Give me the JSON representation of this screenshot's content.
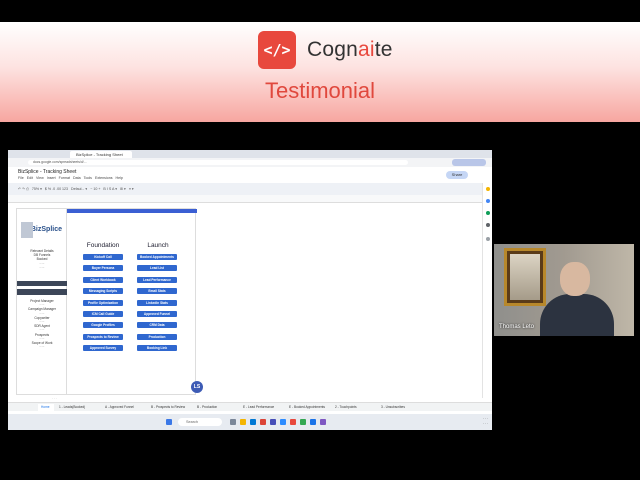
{
  "banner": {
    "logo_glyph": "</>",
    "brand_prefix": "Cogn",
    "brand_ai": "ai",
    "brand_suffix": "te",
    "subtitle": "Testimonial",
    "accent_color": "#e8483d"
  },
  "browser": {
    "tab_label": "BizSplice - Tracking Sheet",
    "doc_title": "BizSplice - Tracking Sheet",
    "share_label": "Share"
  },
  "sheet": {
    "sidebar_logo": "BizSplice",
    "foundation_heading": "Foundation",
    "launch_heading": "Launch",
    "foundation_buttons": [
      "Kickoff Call",
      "Buyer Persona",
      "Client Workbook",
      "Messaging Scripts",
      "Profile Optimization",
      "ICM Call Guide",
      "Google Profiles",
      "Prospects to Review",
      "Approved Survey"
    ],
    "launch_buttons": [
      "Booked Appointments",
      "Lead List",
      "Lead Performance",
      "Email Stats",
      "LinkedIn Stats",
      "Approved Funnel",
      "CRM Data",
      "Production",
      "Booking Link"
    ],
    "badge": "LS"
  },
  "sheet_tabs": [
    "Home",
    "1 - Leads(Booked)",
    "A - Approved Funnel",
    "B - Prospects to Review",
    "B - Production",
    "E - Lead Performance",
    "E - Booked Appointments",
    "2 - Touchpoints",
    "3 - Unsubscribes"
  ],
  "taskbar": {
    "search_placeholder": "Search"
  },
  "webcam": {
    "participant_name": "Thomas Leto"
  }
}
